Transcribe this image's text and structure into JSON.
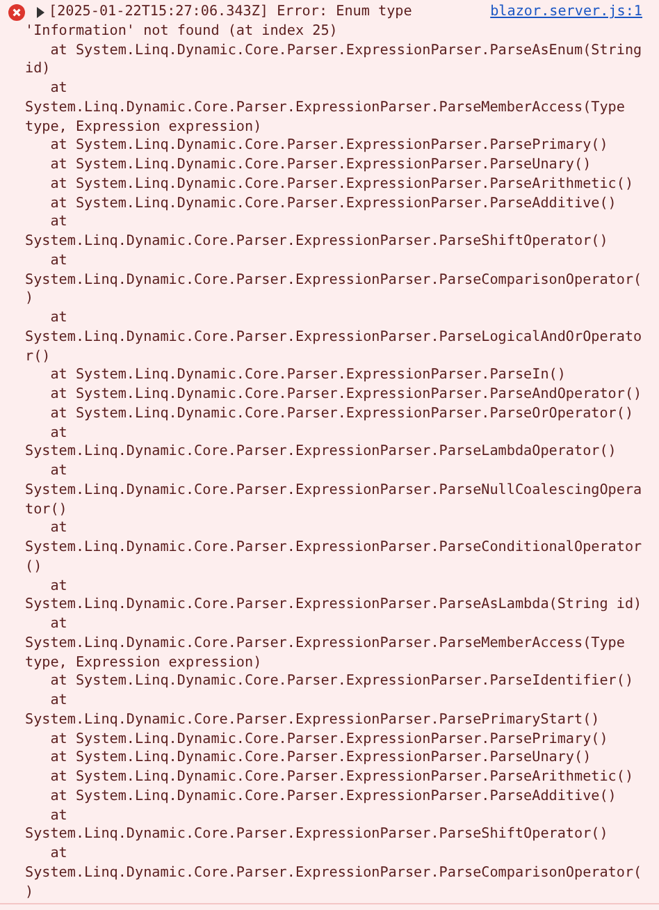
{
  "console_message": {
    "kind": "error",
    "expanded": false,
    "header": "[2025-01-22T15:27:06.343Z] Error: Enum type",
    "source_link": "blazor.server.js:1",
    "lines": [
      "'Information' not found (at index 25)",
      "   at System.Linq.Dynamic.Core.Parser.ExpressionParser.ParseAsEnum(String",
      "id)",
      "   at",
      "System.Linq.Dynamic.Core.Parser.ExpressionParser.ParseMemberAccess(Type",
      "type, Expression expression)",
      "   at System.Linq.Dynamic.Core.Parser.ExpressionParser.ParsePrimary()",
      "   at System.Linq.Dynamic.Core.Parser.ExpressionParser.ParseUnary()",
      "   at System.Linq.Dynamic.Core.Parser.ExpressionParser.ParseArithmetic()",
      "   at System.Linq.Dynamic.Core.Parser.ExpressionParser.ParseAdditive()",
      "   at",
      "System.Linq.Dynamic.Core.Parser.ExpressionParser.ParseShiftOperator()",
      "   at",
      "System.Linq.Dynamic.Core.Parser.ExpressionParser.ParseComparisonOperator(",
      ")",
      "   at",
      "System.Linq.Dynamic.Core.Parser.ExpressionParser.ParseLogicalAndOrOperato",
      "r()",
      "   at System.Linq.Dynamic.Core.Parser.ExpressionParser.ParseIn()",
      "   at System.Linq.Dynamic.Core.Parser.ExpressionParser.ParseAndOperator()",
      "   at System.Linq.Dynamic.Core.Parser.ExpressionParser.ParseOrOperator()",
      "   at",
      "System.Linq.Dynamic.Core.Parser.ExpressionParser.ParseLambdaOperator()",
      "   at",
      "System.Linq.Dynamic.Core.Parser.ExpressionParser.ParseNullCoalescingOpera",
      "tor()",
      "   at",
      "System.Linq.Dynamic.Core.Parser.ExpressionParser.ParseConditionalOperator",
      "()",
      "   at",
      "System.Linq.Dynamic.Core.Parser.ExpressionParser.ParseAsLambda(String id)",
      "   at",
      "System.Linq.Dynamic.Core.Parser.ExpressionParser.ParseMemberAccess(Type",
      "type, Expression expression)",
      "   at System.Linq.Dynamic.Core.Parser.ExpressionParser.ParseIdentifier()",
      "   at",
      "System.Linq.Dynamic.Core.Parser.ExpressionParser.ParsePrimaryStart()",
      "   at System.Linq.Dynamic.Core.Parser.ExpressionParser.ParsePrimary()",
      "   at System.Linq.Dynamic.Core.Parser.ExpressionParser.ParseUnary()",
      "   at System.Linq.Dynamic.Core.Parser.ExpressionParser.ParseArithmetic()",
      "   at System.Linq.Dynamic.Core.Parser.ExpressionParser.ParseAdditive()",
      "   at",
      "System.Linq.Dynamic.Core.Parser.ExpressionParser.ParseShiftOperator()",
      "   at",
      "System.Linq.Dynamic.Core.Parser.ExpressionParser.ParseComparisonOperator(",
      ")"
    ]
  }
}
